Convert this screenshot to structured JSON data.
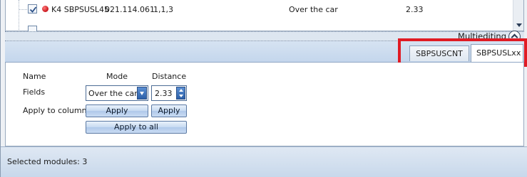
{
  "list": {
    "row": {
      "checked": true,
      "name": "K4 SBPSUSL45",
      "code": "021.114.061",
      "version": "1,1,3",
      "mode": "Over the car",
      "distance": "2.33"
    }
  },
  "multiediting": {
    "label": "Multiediting"
  },
  "tabs": [
    {
      "label": "SBPSUSCNT",
      "active": false
    },
    {
      "label": "SBPSUSLxx",
      "active": true
    }
  ],
  "form": {
    "headers": {
      "name": "Name",
      "mode": "Mode",
      "distance": "Distance"
    },
    "fields_label": "Fields",
    "apply_to_column_label": "Apply to column",
    "mode_value": "Over the car",
    "distance_value": "2.33",
    "apply_mode_label": "Apply",
    "apply_distance_label": "Apply",
    "apply_all_label": "Apply to all"
  },
  "status": {
    "text": "Selected modules: 3"
  },
  "colors": {
    "highlight": "#e01b24",
    "accent": "#2c5fa8"
  }
}
